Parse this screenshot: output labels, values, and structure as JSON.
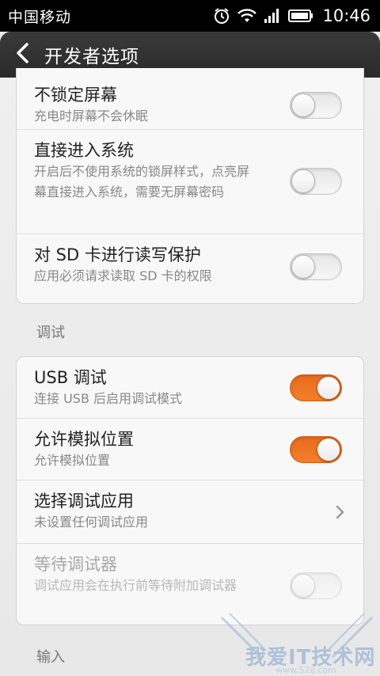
{
  "status_bar": {
    "carrier": "中国移动",
    "time": "10:46",
    "icons": [
      "alarm-icon",
      "wifi-icon",
      "signal-icon",
      "battery-icon"
    ]
  },
  "header": {
    "back_icon": "chevron-left-icon",
    "title": "开发者选项"
  },
  "group_top": {
    "items": [
      {
        "title": "不锁定屏幕",
        "subtitle": "充电时屏幕不会休眠",
        "toggle": false
      },
      {
        "title": "直接进入系统",
        "subtitle": "开启后不使用系统的锁屏样式，点亮屏幕直接进入系统，需要无屏幕密码",
        "toggle": false
      },
      {
        "title": "对 SD 卡进行读写保护",
        "subtitle": "应用必须请求读取 SD 卡的权限",
        "toggle": false
      }
    ]
  },
  "section_debug": {
    "label": "调试",
    "items": [
      {
        "title": "USB 调试",
        "subtitle": "连接 USB 后启用调试模式",
        "toggle": true
      },
      {
        "title": "允许模拟位置",
        "subtitle": "允许模拟位置",
        "toggle": true
      },
      {
        "title": "选择调试应用",
        "subtitle": "未设置任何调试应用",
        "control": "chevron-right-icon"
      },
      {
        "title": "等待调试器",
        "subtitle": "调试应用会在执行前等待附加调试器",
        "toggle": false,
        "disabled": true
      }
    ]
  },
  "section_input": {
    "label": "输入"
  },
  "watermark": {
    "text": "我爱IT技术网",
    "url": "www.52ij.com"
  },
  "colors": {
    "accent": "#f07a28",
    "title_bar": "#333333",
    "background": "#ececec"
  }
}
